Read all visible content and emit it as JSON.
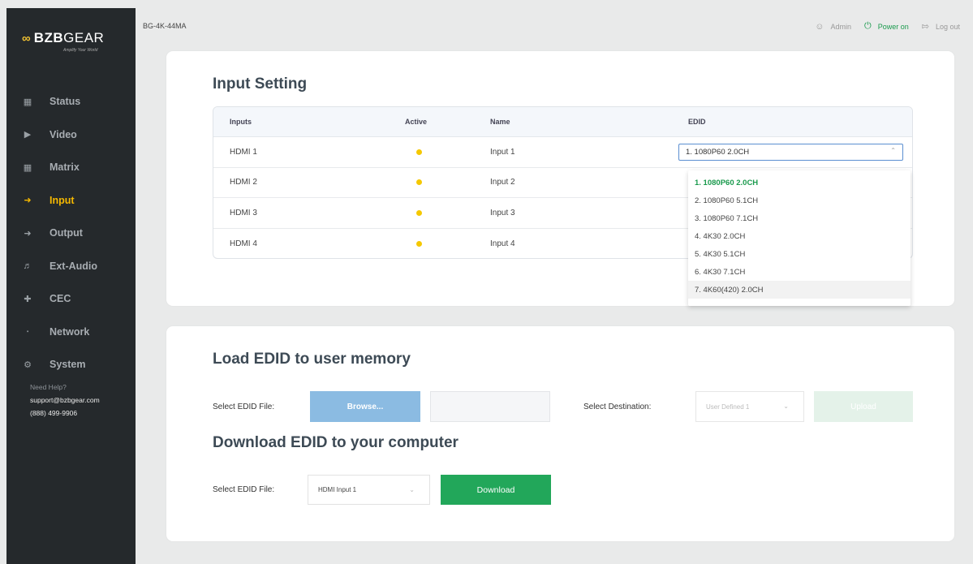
{
  "brand": {
    "logo_prefix": "BZB",
    "logo_suffix": "GEAR",
    "tagline": "Amplify Your World",
    "mark_color": "#f1c232"
  },
  "model": "BG-4K-44MA",
  "header": {
    "admin": "Admin",
    "power": "Power on",
    "logout": "Log out"
  },
  "sidebar": {
    "items": [
      {
        "label": "Status",
        "icon": "status-icon"
      },
      {
        "label": "Video",
        "icon": "video-icon"
      },
      {
        "label": "Matrix",
        "icon": "matrix-icon"
      },
      {
        "label": "Input",
        "icon": "input-icon",
        "active": true
      },
      {
        "label": "Output",
        "icon": "output-icon"
      },
      {
        "label": "Ext-Audio",
        "icon": "audio-icon"
      },
      {
        "label": "CEC",
        "icon": "cec-icon"
      },
      {
        "label": "Network",
        "icon": "network-icon"
      },
      {
        "label": "System",
        "icon": "system-icon"
      }
    ],
    "help_title": "Need Help?",
    "help_email": "support@bzbgear.com",
    "help_phone": "(888) 499-9906",
    "active_color": "#f5b800"
  },
  "input_setting": {
    "title": "Input Setting",
    "columns": [
      "Inputs",
      "Active",
      "Name",
      "EDID"
    ],
    "rows": [
      {
        "input": "HDMI 1",
        "name": "Input 1",
        "edid": "1. 1080P60 2.0CH"
      },
      {
        "input": "HDMI 2",
        "name": "Input 2"
      },
      {
        "input": "HDMI 3",
        "name": "Input 3"
      },
      {
        "input": "HDMI 4",
        "name": "Input 4"
      }
    ],
    "active_dot_color": "#f5c800",
    "edid_options": [
      "1. 1080P60 2.0CH",
      "2. 1080P60 5.1CH",
      "3. 1080P60 7.1CH",
      "4. 4K30 2.0CH",
      "5. 4K30 5.1CH",
      "6. 4K30 7.1CH",
      "7. 4K60(420) 2.0CH"
    ]
  },
  "load_edid": {
    "title": "Load EDID to user memory",
    "file_label": "Select EDID File:",
    "browse_label": "Browse...",
    "destination_label": "Select Destination:",
    "destination_value": "User Defined 1",
    "upload_label": "Upload"
  },
  "download_edid": {
    "title": "Download EDID to your computer",
    "file_label": "Select EDID File:",
    "file_value": "HDMI Input 1",
    "download_label": "Download",
    "download_color": "#22a75a"
  }
}
